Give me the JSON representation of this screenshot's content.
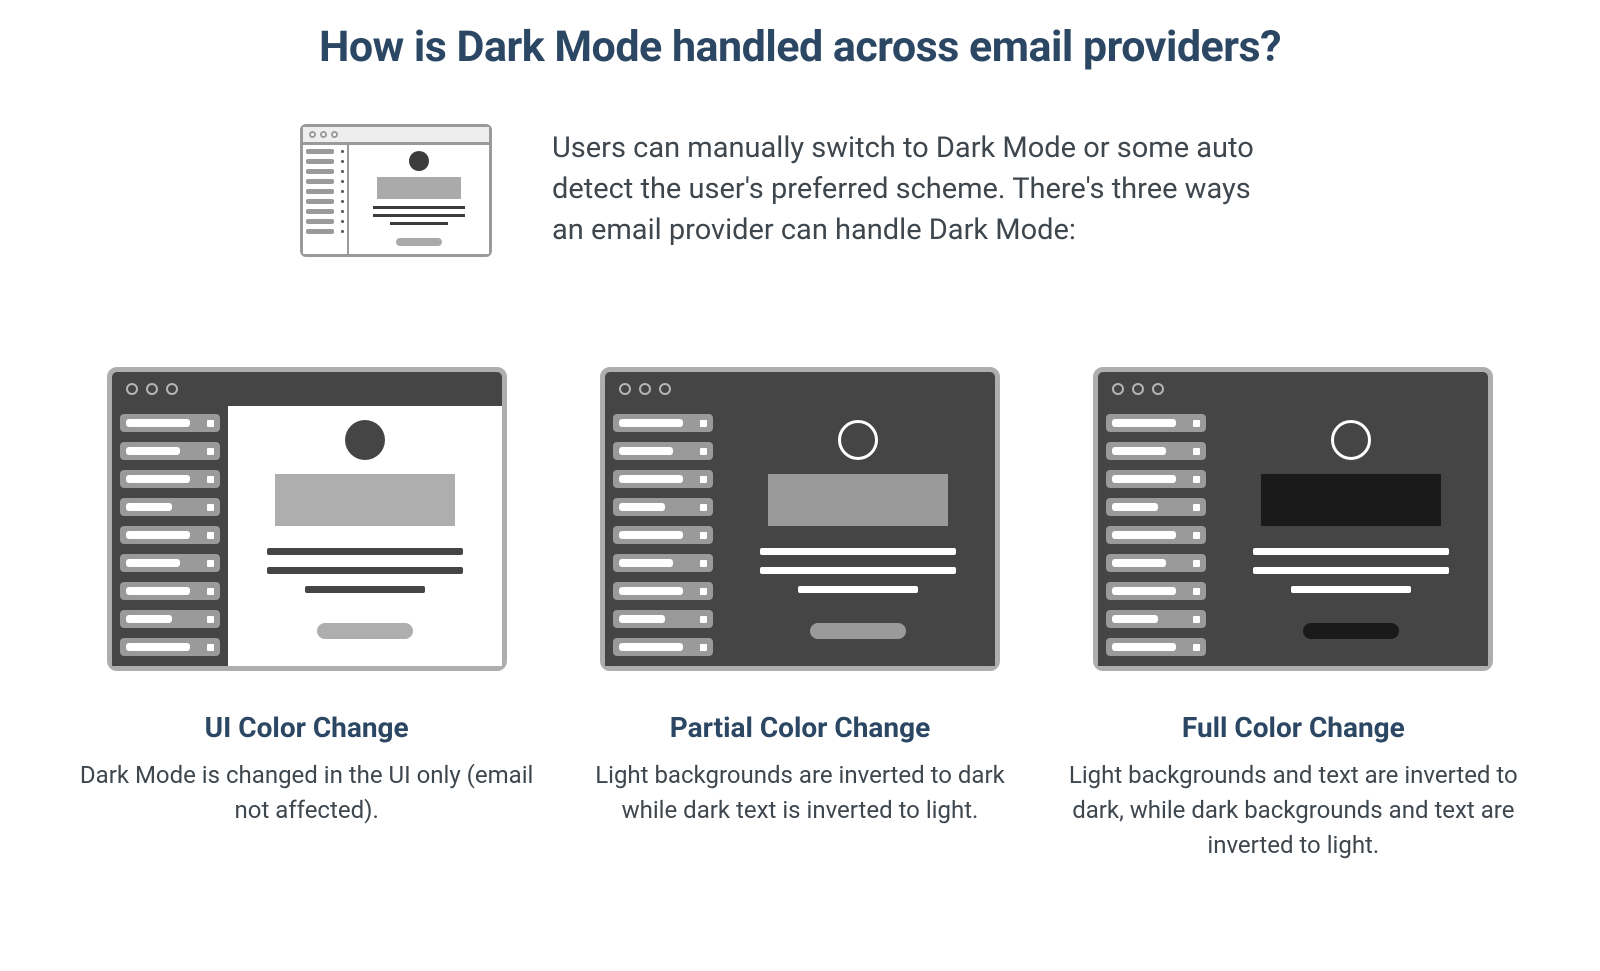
{
  "title": "How is Dark Mode handled across email providers?",
  "intro": "Users can manually switch to Dark Mode or some auto detect the user's preferred scheme. There's three ways an email provider can handle Dark Mode:",
  "columns": [
    {
      "title": "UI Color Change",
      "desc": "Dark Mode is changed in the UI only (email not affected)."
    },
    {
      "title": "Partial Color Change",
      "desc": "Light backgrounds are inverted to dark while dark text is inverted to light."
    },
    {
      "title": "Full Color Change",
      "desc": "Light backgrounds and text are inverted to dark, while dark backgrounds and text are inverted to light."
    }
  ],
  "colors": {
    "heading": "#2b4763",
    "text": "#3e464e",
    "chrome_dark": "#454545",
    "chrome_mid": "#aeaeae",
    "chrome_light": "#ffffff"
  }
}
